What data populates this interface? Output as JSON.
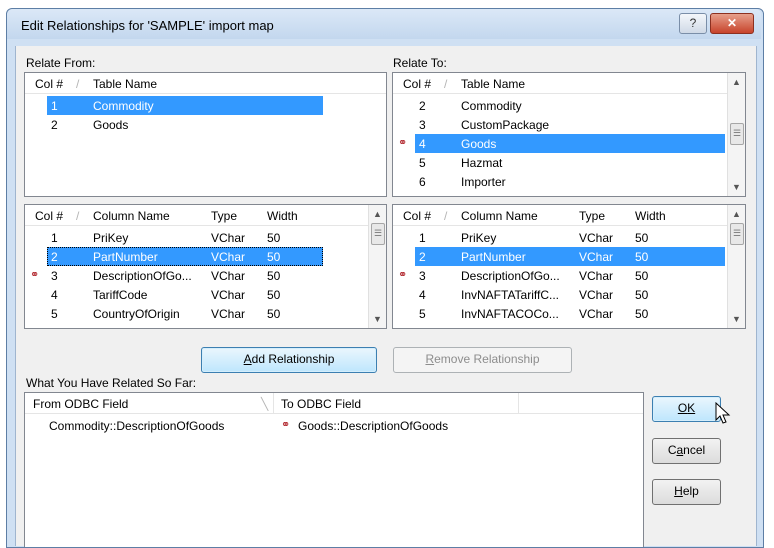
{
  "window": {
    "title": "Edit Relationships for 'SAMPLE' import map",
    "help_glyph": "?",
    "close_glyph": "✕"
  },
  "relate_from": {
    "label": "Relate From:",
    "headers": [
      "Col #",
      "Table Name"
    ],
    "rows": [
      {
        "col": "1",
        "name": "Commodity"
      },
      {
        "col": "2",
        "name": "Goods"
      }
    ]
  },
  "relate_to": {
    "label": "Relate To:",
    "headers": [
      "Col #",
      "Table Name"
    ],
    "rows": [
      {
        "col": "2",
        "name": "Commodity"
      },
      {
        "col": "3",
        "name": "CustomPackage"
      },
      {
        "col": "4",
        "name": "Goods"
      },
      {
        "col": "5",
        "name": "Hazmat"
      },
      {
        "col": "6",
        "name": "Importer"
      }
    ]
  },
  "from_columns": {
    "headers": [
      "Col #",
      "Column Name",
      "Type",
      "Width"
    ],
    "rows": [
      {
        "col": "1",
        "name": "PriKey",
        "type": "VChar",
        "width": "50"
      },
      {
        "col": "2",
        "name": "PartNumber",
        "type": "VChar",
        "width": "50"
      },
      {
        "col": "3",
        "name": "DescriptionOfGo...",
        "type": "VChar",
        "width": "50"
      },
      {
        "col": "4",
        "name": "TariffCode",
        "type": "VChar",
        "width": "50"
      },
      {
        "col": "5",
        "name": "CountryOfOrigin",
        "type": "VChar",
        "width": "50"
      }
    ]
  },
  "to_columns": {
    "headers": [
      "Col #",
      "Column Name",
      "Type",
      "Width"
    ],
    "rows": [
      {
        "col": "1",
        "name": "PriKey",
        "type": "VChar",
        "width": "50"
      },
      {
        "col": "2",
        "name": "PartNumber",
        "type": "VChar",
        "width": "50"
      },
      {
        "col": "3",
        "name": "DescriptionOfGo...",
        "type": "VChar",
        "width": "50"
      },
      {
        "col": "4",
        "name": "InvNAFTATariffC...",
        "type": "VChar",
        "width": "50"
      },
      {
        "col": "5",
        "name": "InvNAFTACOCo...",
        "type": "VChar",
        "width": "50"
      }
    ]
  },
  "buttons": {
    "add_mnemonic": "A",
    "add_rest": "dd Relationship",
    "remove_mnemonic": "R",
    "remove_rest": "emove Relationship",
    "ok_mnemonic": "O",
    "ok_rest": "K",
    "cancel_pre": "C",
    "cancel_mnemonic": "a",
    "cancel_rest": "ncel",
    "help_mnemonic": "H",
    "help_rest": "elp"
  },
  "related": {
    "label": "What You Have Related So Far:",
    "headers": [
      "From ODBC Field",
      "To ODBC Field"
    ],
    "rows": [
      {
        "from": "Commodity::DescriptionOfGoods",
        "to": "Goods::DescriptionOfGoods"
      }
    ]
  },
  "colors": {
    "selection": "#3399ff",
    "link_icon": "#b0232a"
  },
  "icons": {
    "link": "chain-link-icon",
    "sort": "sort-indicator-icon",
    "cursor": "mouse-pointer-icon"
  }
}
